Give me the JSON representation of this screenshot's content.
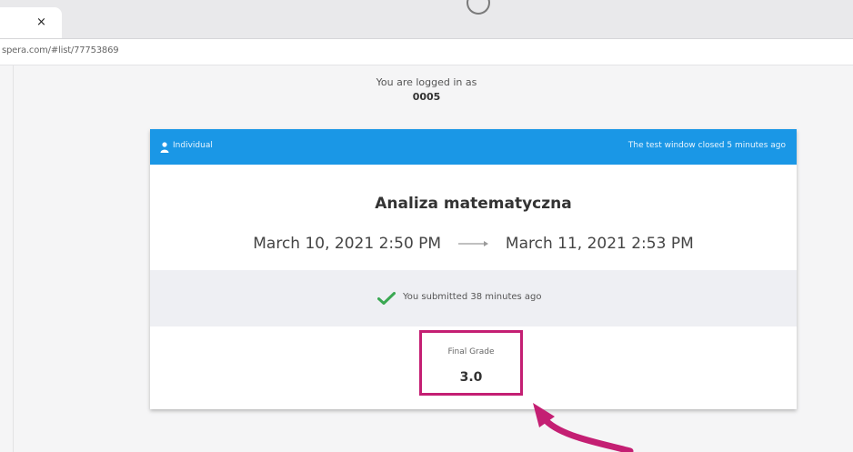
{
  "browser": {
    "tab_close_icon": "×",
    "url": "spera.com/#list/77753869"
  },
  "login": {
    "label": "You are logged in as",
    "user": "0005"
  },
  "card": {
    "header_left": "Individual",
    "header_right": "The test window closed 5 minutes ago",
    "title": "Analiza matematyczna",
    "start": "March 10, 2021 2:50 PM",
    "end": "March 11, 2021 2:53 PM",
    "submitted": "You submitted 38 minutes ago",
    "grade_label": "Final Grade",
    "grade_value": "3.0"
  },
  "colors": {
    "header_blue": "#1a97e6",
    "highlight_magenta": "#c41f73",
    "check_green": "#3aa852"
  },
  "icons": [
    "close-icon",
    "loading-icon",
    "user-icon",
    "arrow-right-icon",
    "checkmark-icon",
    "curved-arrow-annotation"
  ]
}
